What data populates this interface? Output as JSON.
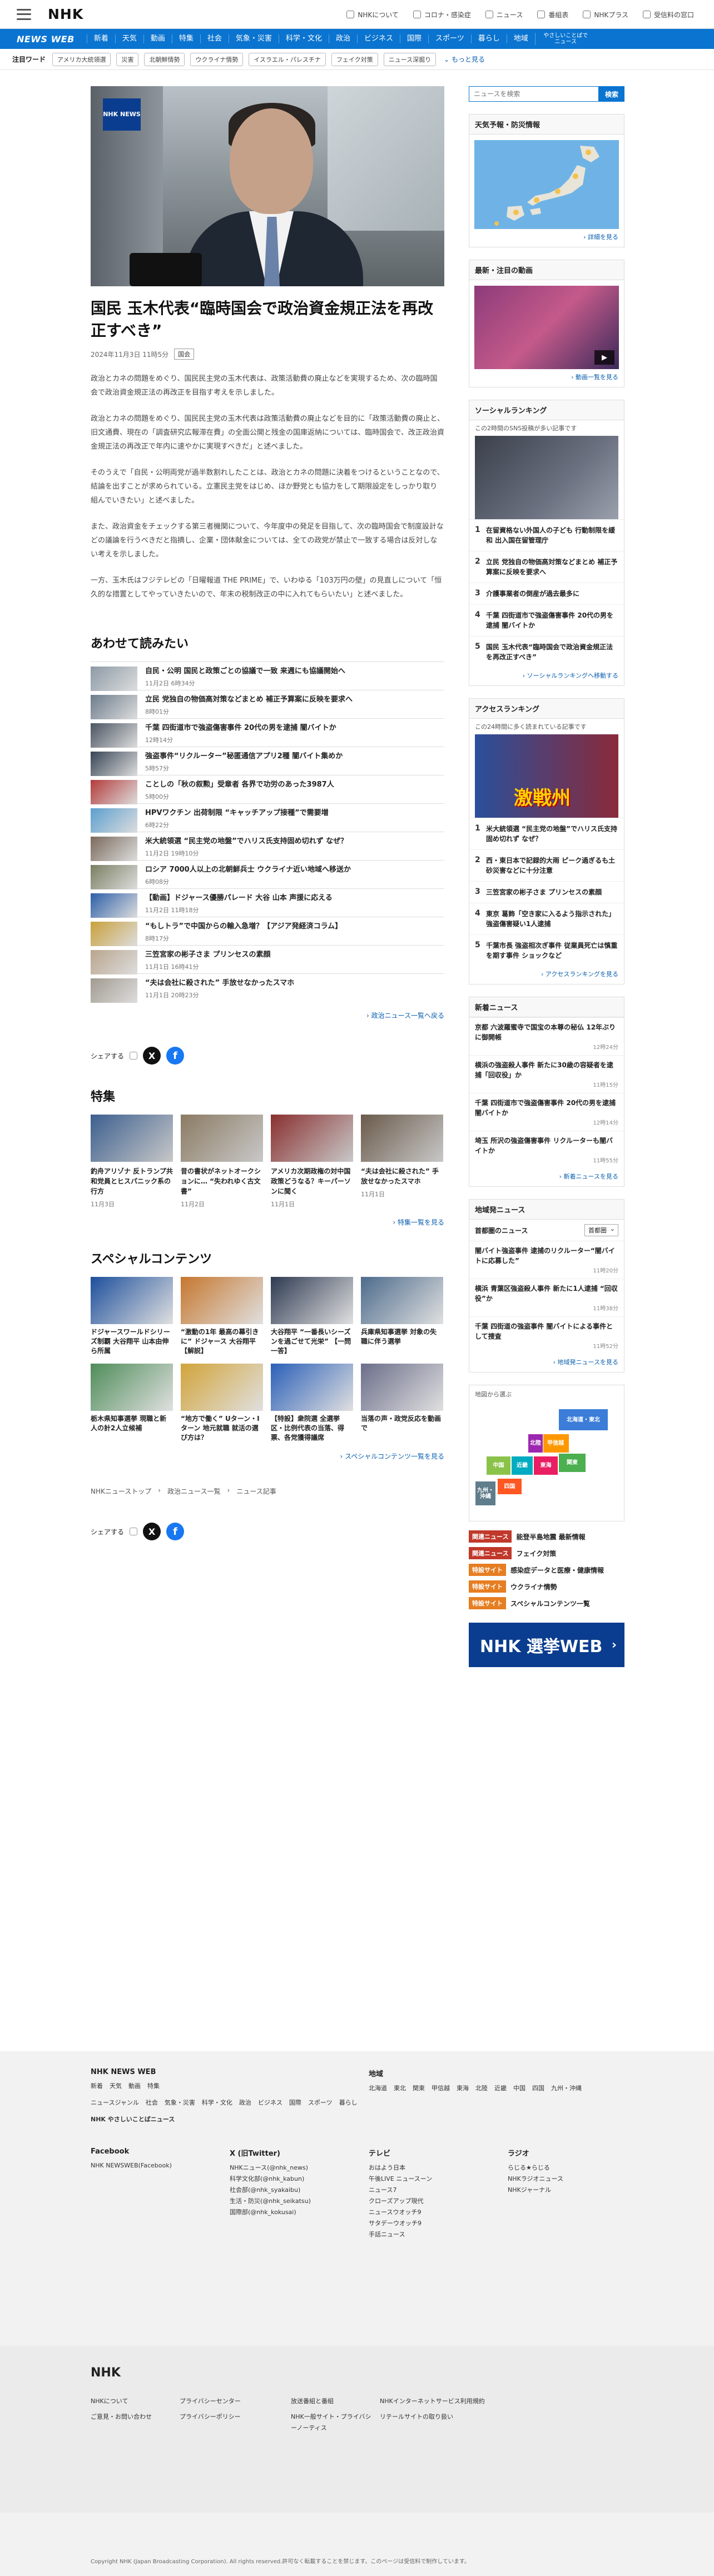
{
  "header": {
    "logo": "NHK",
    "utilities": [
      {
        "icon": "nhk-icon",
        "label": "NHKについて"
      },
      {
        "icon": "corona-icon",
        "label": "コロナ・感染症"
      },
      {
        "icon": "news-icon",
        "label": "ニュース"
      },
      {
        "icon": "tv-icon",
        "label": "番組表"
      },
      {
        "icon": "plus-icon",
        "label": "NHKプラス"
      },
      {
        "icon": "login-icon",
        "label": "受信料の窓口"
      }
    ]
  },
  "nav": {
    "brand": "NEWS WEB",
    "items": [
      "新着",
      "天気",
      "動画",
      "特集",
      "社会",
      "気象・災害",
      "科学・文化",
      "政治",
      "ビジネス",
      "国際",
      "スポーツ",
      "暮らし",
      "地域"
    ],
    "easy": "やさしいことばでニュース"
  },
  "topics": {
    "title": "注目ワード",
    "chips": [
      "アメリカ大統領選",
      "災害",
      "北朝鮮情勢",
      "ウクライナ情勢",
      "イスラエル・パレスチナ",
      "フェイク対策",
      "ニュース深掘り"
    ],
    "more": "もっと見る"
  },
  "article": {
    "badge": "NHK NEWS",
    "title": "国民 玉木代表“臨時国会で政治資金規正法を再改正すべき”",
    "date": "2024年11月3日 11時5分",
    "tag": "国会",
    "paragraphs": [
      "政治とカネの問題をめぐり、国民民主党の玉木代表は、政策活動費の廃止などを実現するため、次の臨時国会で政治資金規正法の再改正を目指す考えを示しました。",
      "政治とカネの問題をめぐり、国民民主党の玉木代表は政策活動費の廃止などを目的に「政策活動費の廃止と、旧文通費、現在の「調査研究広報滞在費」の全面公開と残金の国庫返納については、臨時国会で、改正政治資金規正法の再改正で年内に速やかに実現すべきだ」と述べました。",
      "そのうえで「自民・公明両党が過半数割れしたことは、政治とカネの問題に決着をつけるということなので、結論を出すことが求められている。立憲民主党をはじめ、ほか野党とも協力をして期限設定をしっかり取り組んでいきたい」と述べました。",
      "また、政治資金をチェックする第三者機関について、今年度中の発足を目指して、次の臨時国会で制度設計などの議論を行うべきだと指摘し、企業・団体献金については、全ての政党が禁止で一致する場合は反対しない考えを示しました。",
      "一方、玉木氏はフジテレビの「日曜報道 THE PRIME」で、いわゆる「103万円の壁」の見直しについて「恒久的な措置としてやっていきたいので、年末の税制改正の中に入れてもらいたい」と述べました。"
    ]
  },
  "related": {
    "title": "あわせて読みたい",
    "items": [
      {
        "title": "自民・公明 国民と政策ごとの協議で一致 来週にも協議開始へ",
        "date": "11月2日 6時34分",
        "color": "#8c9aa6"
      },
      {
        "title": "立民 党独自の物価高対策などまとめ 補正予算案に反映を要求へ",
        "date": "8時01分",
        "color": "#6d7c8c"
      },
      {
        "title": "千葉 四街道市で強盗傷害事件 20代の男を逮捕 闇バイトか",
        "date": "12時14分",
        "color": "#4b5563"
      },
      {
        "title": "強盗事件“リクルーター”秘匿通信アプリ2種 闇バイト集めか",
        "date": "5時57分",
        "color": "#384556"
      },
      {
        "title": "ことしの「秋の叙勲」受章者 各界で功労のあった3987人",
        "date": "5時00分",
        "color": "#b33b3b"
      },
      {
        "title": "HPVワクチン 出荷制限 “キャッチアップ接種”で需要増",
        "date": "6時22分",
        "color": "#5b9fcf"
      },
      {
        "title": "米大統領選 “民主党の地盤”でハリス氏支持固め切れず なぜ？",
        "date": "11月2日 19時10分",
        "color": "#7a6a5c"
      },
      {
        "title": "ロシア 7000人以上の北朝鮮兵士 ウクライナ近い地域へ移送か",
        "date": "6時08分",
        "color": "#7b7f62"
      },
      {
        "title": "【動画】ドジャース優勝パレード 大谷 山本 声援に応える",
        "date": "11月2日 11時18分",
        "color": "#2d5fa8"
      },
      {
        "title": "“もしトラ”で中国からの輸入急増？【アジア発経済コラム】",
        "date": "8時17分",
        "color": "#c9a03b"
      },
      {
        "title": "三笠宮家の彬子さま プリンセスの素顔",
        "date": "11月1日 16時41分",
        "color": "#b9a58d"
      },
      {
        "title": "“夫は会社に殺された” 手放せなかったスマホ",
        "date": "11月1日 20時23分",
        "color": "#a19a90"
      }
    ],
    "more": "政治ニュース一覧へ戻る"
  },
  "share": {
    "label": "シェアする"
  },
  "feature": {
    "title": "特集",
    "items": [
      {
        "title": "釣舟アリゾナ 反トランプ共和党員とヒスパニック系の行方",
        "date": "11月3日",
        "color": "#3c5f8f"
      },
      {
        "title": "昔の書状がネットオークションに… “失われゆく古文書”",
        "date": "11月2日",
        "color": "#8b7b63"
      },
      {
        "title": "アメリカ次期政権の対中国政策どうなる？キーパーソンに聞く",
        "date": "11月1日",
        "color": "#8a2f2f"
      },
      {
        "title": "“夫は会社に殺された” 手放せなかったスマホ",
        "date": "11月1日",
        "color": "#6a5a4a"
      }
    ],
    "more": "特集一覧を見る"
  },
  "special": {
    "title": "スペシャルコンテンツ",
    "items": [
      {
        "title": "ドジャースワールドシリーズ制覇 大谷翔平 山本由伸ら所属",
        "color": "#1d4f9c"
      },
      {
        "title": "“激動の1年 最高の幕引きに” ドジャース 大谷翔平【解説】",
        "color": "#c6772e"
      },
      {
        "title": "大谷翔平 “一番長いシーズンを過ごせて光栄” 【一問一答】",
        "color": "#2e3a52"
      },
      {
        "title": "兵庫県知事選挙 対象の失職に伴う選挙",
        "color": "#4d6b8c"
      },
      {
        "title": "栃木県知事選挙 現職と新人の計2人立候補",
        "color": "#4f8d5a"
      },
      {
        "title": "“地方で働く” Uターン・Iターン 地元就職 就活の選び方は？",
        "color": "#d2a43a"
      },
      {
        "title": "【特設】衆院選 全選挙区・比例代表の当落、得票、各党獲得議席",
        "color": "#2a5fb8"
      },
      {
        "title": "当落の声・政党反応を動画で",
        "color": "#6b6e8a"
      }
    ],
    "more": "スペシャルコンテンツ一覧を見る"
  },
  "breadcrumb": [
    "NHKニューストップ",
    "政治ニュース一覧",
    "ニュース記事"
  ],
  "sidebar": {
    "search": {
      "placeholder": "ニュースを検索",
      "button": "検索"
    },
    "weather": {
      "title": "天気予報・防災情報",
      "more": "詳細を見る"
    },
    "video": {
      "title": "最新・注目の動画",
      "more": "動画一覧を見る"
    },
    "social": {
      "title": "ソーシャルランキング",
      "sub": "この2時間のSNS投稿が多い記事です",
      "items": [
        "在留資格ない外国人の子ども 行動制限を緩和 出入国在留管理庁",
        "立民 党独自の物価高対策などまとめ 補正予算案に反映を要求へ",
        "介護事業者の倒産が過去最多に",
        "千葉 四街道市で強盗傷害事件 20代の男を逮捕 闇バイトか",
        "国民 玉木代表“臨時国会で政治資金規正法を再改正すべき”"
      ],
      "more": "ソーシャルランキングへ移動する"
    },
    "access": {
      "title": "アクセスランキング",
      "sub": "この24時間に多く読まれている記事です",
      "banner": "激戦州",
      "items": [
        "米大統領選 “民主党の地盤”でハリス氏支持固め切れず なぜ？",
        "西・東日本で記録的大雨 ピーク過ぎるも土砂災害などに十分注意",
        "三笠宮家の彬子さま プリンセスの素顔",
        "東京 葛飾「空き家に入るよう指示された」強盗傷害疑い1人逮捕",
        "千葉市長 強盗相次ぎ事件 従業員死亡は慎重を期す事件 ショックなど"
      ],
      "more": "アクセスランキングを見る"
    },
    "latest": {
      "title": "新着ニュース",
      "items": [
        {
          "title": "京都 六波羅蜜寺で国宝の本尊の秘仏 12年ぶりに御開帳",
          "date": "12時24分"
        },
        {
          "title": "横浜の強盗殺人事件 新たに30歳の容疑者を逮捕「回収役」か",
          "date": "11時15分"
        },
        {
          "title": "千葉 四街道市で強盗傷害事件 20代の男を逮捕 闇バイトか",
          "date": "12時14分"
        },
        {
          "title": "埼玉 所沢の強盗傷害事件 リクルーターも闇バイトか",
          "date": "11時55分"
        }
      ],
      "more": "新着ニュースを見る"
    },
    "regional": {
      "title": "地域発ニュース",
      "area_label": "首都圏のニュース",
      "select": "首都圏",
      "items": [
        {
          "title": "闇バイト強盗事件 逮捕のリクルーター“闇バイトに応募した”",
          "date": "11時20分"
        },
        {
          "title": "横浜 青葉区強盗殺人事件 新たに1人逮捕 “回収役”か",
          "date": "11時38分"
        },
        {
          "title": "千葉 四街道の強盗事件 闇バイトによる事件として捜査",
          "date": "11時52分"
        }
      ],
      "more": "地域発ニュースを見る",
      "map_label": "地図から選ぶ",
      "regions": [
        "北海道・東北",
        "関東",
        "甲信越",
        "東海",
        "北陸",
        "近畿",
        "中国",
        "四国",
        "九州・沖縄"
      ]
    },
    "banners": [
      {
        "tag": "関連ニュース",
        "tag_color": "#c0392b",
        "text": "能登半島地震 最新情報"
      },
      {
        "tag": "関連ニュース",
        "tag_color": "#c0392b",
        "text": "フェイク対策"
      },
      {
        "tag": "特設サイト",
        "tag_color": "#e67e22",
        "text": "感染症データと医療・健康情報"
      },
      {
        "tag": "特設サイト",
        "tag_color": "#e67e22",
        "text": "ウクライナ情勢"
      },
      {
        "tag": "特設サイト",
        "tag_color": "#e67e22",
        "text": "スペシャルコンテンツ一覧"
      }
    ],
    "election": {
      "text": "NHK 選挙WEB"
    }
  },
  "footer": {
    "title": "NHK NEWS WEB",
    "cols1": [
      "新着",
      "天気",
      "動画",
      "特集"
    ],
    "cols2": [
      "ニュースジャンル",
      "社会",
      "気象・災害",
      "科学・文化",
      "政治",
      "ビジネス",
      "国際",
      "スポーツ",
      "暮らし"
    ],
    "easy": "NHK やさしいことばニュース",
    "region_title": "地域",
    "regions": [
      "北海道",
      "東北",
      "関東",
      "甲信越",
      "東海",
      "北陸",
      "近畿",
      "中国",
      "四国",
      "九州・沖縄"
    ],
    "facebook": {
      "title": "Facebook",
      "items": [
        "NHK NEWSWEB(Facebook)"
      ]
    },
    "x": {
      "title": "X (旧Twitter)",
      "items": [
        "NHKニュース(@nhk_news)",
        "科学文化部(@nhk_kabun)",
        "社会部(@nhk_syakaibu)",
        "生活・防災(@nhk_seikatsu)",
        "国際部(@nhk_kokusai)"
      ]
    },
    "tv": {
      "title": "テレビ",
      "items": [
        "おはよう日本",
        "午後LIVE ニュースーン",
        "ニュース7",
        "クローズアップ現代",
        "ニュースウオッチ9",
        "サタデーウオッチ9",
        "手話ニュース"
      ]
    },
    "radio": {
      "title": "ラジオ",
      "items": [
        "らじる★らじる",
        "NHKラジオニュース",
        "NHKジャーナル"
      ]
    },
    "bottom_logo": "NHK",
    "bottom_links": [
      "NHKについて",
      "プライバシーセンター",
      "放送番組と番組",
      "NHKインターネットサービス利用規約",
      "ご意見・お問い合わせ",
      "プライバシーポリシー",
      "NHK一般サイト・プライバシーノーティス",
      "リテールサイトの取り扱い"
    ],
    "copyright": "Copyright NHK (Japan Broadcasting Corporation). All rights reserved.許可なく転載することを禁じます。このページは受信料で制作しています。"
  }
}
